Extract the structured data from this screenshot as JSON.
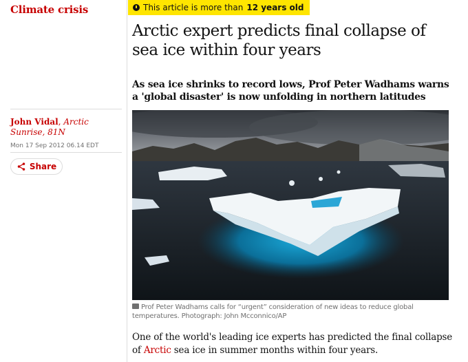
{
  "section": {
    "label": "Climate crisis"
  },
  "age_notice": {
    "prefix": "This article is more than",
    "age": "12 years old"
  },
  "article": {
    "headline": "Arctic expert predicts final collapse of sea ice within four years",
    "standfirst": "As sea ice shrinks to record lows, Prof Peter Wadhams warns a 'global disaster' is now unfolding in northern latitudes",
    "byline": {
      "author": "John Vidal",
      "separator": ",",
      "role": "Arctic Sunrise, 81N"
    },
    "dateline": "Mon 17 Sep 2012 06.14 EDT",
    "share_label": "Share",
    "image_caption": "Prof Peter Wadhams calls for “urgent” consideration of new ideas to reduce global temperatures. Photograph: John Mcconnico/AP",
    "body_intro_before": "One of the world's leading ice experts has predicted the final collapse of",
    "body_link": "Arctic",
    "body_intro_after": "sea ice in summer months within four years."
  },
  "colors": {
    "accent": "#c70000",
    "badge": "#ffe500",
    "text": "#121212",
    "muted": "#707070"
  },
  "icons": {
    "age_notice": "clock-icon",
    "share": "share-icon",
    "caption": "camera-icon"
  }
}
